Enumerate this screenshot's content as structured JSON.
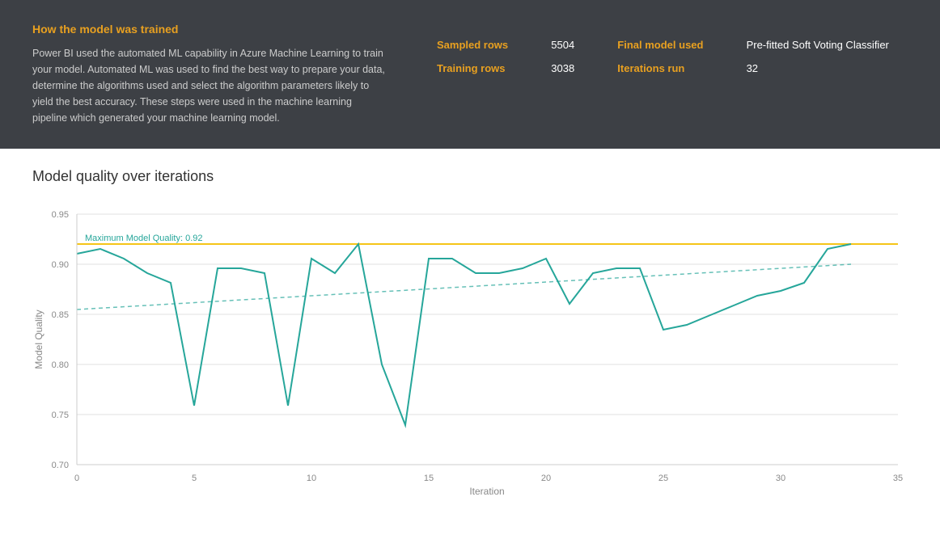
{
  "top_panel": {
    "title": "How the model was trained",
    "description": "Power BI used the automated ML capability in Azure Machine Learning to train your model. Automated ML was used to find the best way to prepare your data, determine the algorithms used and select the algorithm parameters likely to yield the best accuracy. These steps were used in the machine learning pipeline which generated your machine learning model."
  },
  "stats": {
    "sampled_rows_label": "Sampled rows",
    "sampled_rows_value": "5504",
    "training_rows_label": "Training rows",
    "training_rows_value": "3038",
    "final_model_label": "Final model used",
    "final_model_value": "Pre-fitted Soft Voting Classifier",
    "iterations_label": "Iterations run",
    "iterations_value": "32"
  },
  "chart": {
    "title": "Model quality over iterations",
    "x_label": "Iteration",
    "y_label": "Model Quality",
    "max_quality_label": "Maximum Model Quality: 0.92",
    "max_quality_value": 0.92
  }
}
